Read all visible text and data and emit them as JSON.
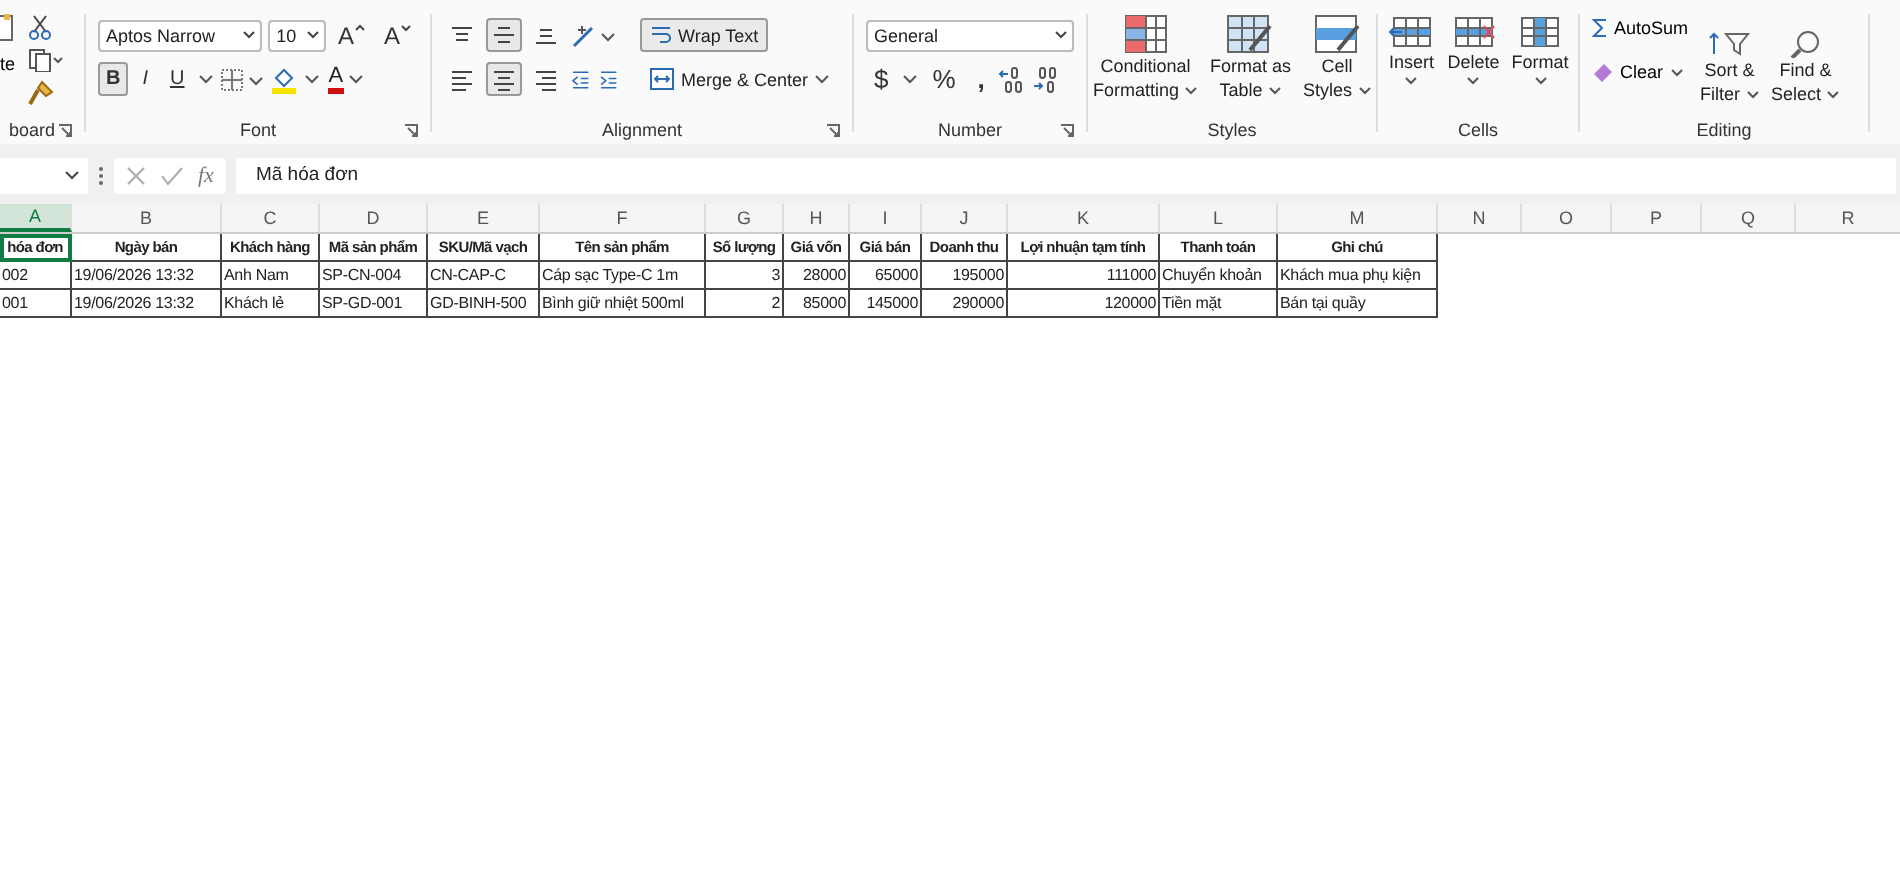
{
  "ribbon": {
    "clipboard": {
      "paste": "te",
      "label": "board"
    },
    "font": {
      "font_name": "Aptos Narrow",
      "font_size": "10",
      "grow": "A",
      "shrink": "A",
      "format_buttons": [
        {
          "label": "B",
          "selected": true
        },
        {
          "label": "I",
          "selected": false
        },
        {
          "label": "U",
          "selected": false
        }
      ],
      "font_color_glyph": "A",
      "label": "Font"
    },
    "alignment": {
      "vertical": [
        {
          "kind": "top",
          "selected": false
        },
        {
          "kind": "middle",
          "selected": true
        },
        {
          "kind": "bottom",
          "selected": false
        }
      ],
      "horizontal": [
        {
          "kind": "left",
          "selected": false
        },
        {
          "kind": "center",
          "selected": true
        },
        {
          "kind": "right",
          "selected": false
        }
      ],
      "wrap_text": {
        "label": "Wrap Text",
        "selected": true
      },
      "merge": "Merge & Center",
      "label": "Alignment"
    },
    "number": {
      "format": "General",
      "symbols": [
        "$",
        "%",
        ","
      ],
      "label": "Number"
    },
    "styles": {
      "buttons": [
        {
          "kind": "conditional",
          "lines": [
            "Conditional",
            "Formatting"
          ]
        },
        {
          "kind": "table",
          "lines": [
            "Format as",
            "Table"
          ]
        },
        {
          "kind": "cell",
          "lines": [
            "Cell",
            "Styles"
          ]
        }
      ],
      "label": "Styles"
    },
    "cells": {
      "buttons": [
        {
          "kind": "insert",
          "label": "Insert"
        },
        {
          "kind": "delete",
          "label": "Delete"
        },
        {
          "kind": "format",
          "label": "Format"
        }
      ],
      "label": "Cells"
    },
    "editing": {
      "autosum": "AutoSum",
      "clear": "Clear",
      "buttons": [
        {
          "kind": "sort",
          "lines": [
            "Sort &",
            "Filter"
          ]
        },
        {
          "kind": "find",
          "lines": [
            "Find &",
            "Select"
          ]
        }
      ],
      "label": "Editing"
    }
  },
  "formula_bar": {
    "fx": "fx",
    "value": "Mã hóa đơn"
  },
  "sheet": {
    "columns": [
      {
        "letter": "A",
        "selected": true,
        "kind": "text"
      },
      {
        "letter": "B",
        "selected": false,
        "kind": "text"
      },
      {
        "letter": "C",
        "selected": false,
        "kind": "text"
      },
      {
        "letter": "D",
        "selected": false,
        "kind": "text"
      },
      {
        "letter": "E",
        "selected": false,
        "kind": "text"
      },
      {
        "letter": "F",
        "selected": false,
        "kind": "text"
      },
      {
        "letter": "G",
        "selected": false,
        "kind": "number"
      },
      {
        "letter": "H",
        "selected": false,
        "kind": "number"
      },
      {
        "letter": "I",
        "selected": false,
        "kind": "number"
      },
      {
        "letter": "J",
        "selected": false,
        "kind": "number"
      },
      {
        "letter": "K",
        "selected": false,
        "kind": "number"
      },
      {
        "letter": "L",
        "selected": false,
        "kind": "text"
      },
      {
        "letter": "M",
        "selected": false,
        "kind": "text"
      },
      {
        "letter": "N",
        "selected": false
      },
      {
        "letter": "O",
        "selected": false
      },
      {
        "letter": "P",
        "selected": false
      },
      {
        "letter": "Q",
        "selected": false
      },
      {
        "letter": "R",
        "selected": false
      }
    ],
    "rows": [
      {
        "kind": "header",
        "cells": [
          "hóa đơn",
          "Ngày bán",
          "Khách hàng",
          "Mã sản phẩm",
          "SKU/Mã vạch",
          "Tên sản phẩm",
          "Số lượng",
          "Giá vốn",
          "Giá bán",
          "Doanh thu",
          "Lợi nhuận tạm tính",
          "Thanh toán",
          "Ghi chú"
        ]
      },
      {
        "kind": "data",
        "cells": [
          "002",
          "19/06/2026 13:32",
          "Anh Nam",
          "SP-CN-004",
          "CN-CAP-C",
          "Cáp sạc Type-C 1m",
          "3",
          "28000",
          "65000",
          "195000",
          "111000",
          "Chuyển khoản",
          "Khách mua phụ kiện"
        ]
      },
      {
        "kind": "data",
        "cells": [
          "001",
          "19/06/2026 13:32",
          "Khách lẻ",
          "SP-GD-001",
          "GD-BINH-500",
          "Bình giữ nhiệt 500ml",
          "2",
          "85000",
          "145000",
          "290000",
          "120000",
          "Tiền mặt",
          "Bán tại quầy"
        ]
      }
    ]
  }
}
